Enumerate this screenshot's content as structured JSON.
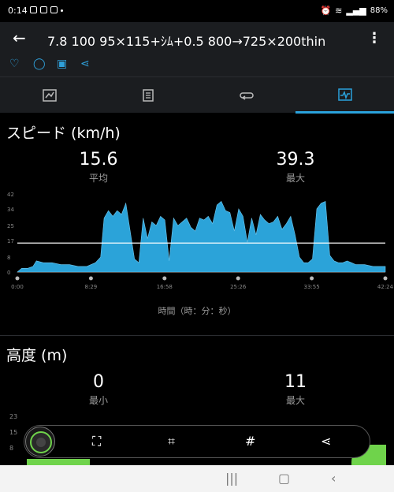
{
  "status": {
    "time": "0:14",
    "battery": "88%"
  },
  "toolbar": {
    "title": "7.8 100 95×115+ｼﾑ+0.5 800→725×200thin"
  },
  "speed": {
    "title": "スピード (km/h)",
    "avg_value": "15.6",
    "avg_label": "平均",
    "max_value": "39.3",
    "max_label": "最大"
  },
  "altitude": {
    "title": "高度 (m)",
    "min_value": "0",
    "min_label": "最小",
    "max_value": "11",
    "max_label": "最大",
    "y_ticks": [
      "23",
      "15",
      "8"
    ]
  },
  "chart_data": {
    "type": "area",
    "title": "スピード (km/h)",
    "xlabel": "時間（時：分：秒）",
    "ylabel": "",
    "x_ticks": [
      "0:00",
      "8:29",
      "16:58",
      "25:26",
      "33:55",
      "42:24"
    ],
    "y_ticks": [
      "42",
      "34",
      "25",
      "17",
      "8",
      "0"
    ],
    "ylim": [
      0,
      42
    ],
    "xlim": [
      0,
      42.4
    ],
    "average_line": 15.6,
    "color": "#2ba3d9",
    "series": [
      {
        "x": [
          0,
          0.5,
          1.2,
          1.8,
          2.2,
          3.0,
          4.0,
          5.0,
          6.0,
          7.0,
          8.0,
          9.0,
          9.6,
          10.0,
          10.5,
          11.0,
          11.5,
          12.0,
          12.5,
          13.0,
          13.5,
          14.0,
          14.5,
          15.0,
          15.5,
          16.0,
          16.5,
          17.0,
          17.5,
          18.0,
          18.5,
          19.0,
          19.5,
          20.0,
          20.5,
          21.0,
          21.5,
          22.0,
          22.5,
          23.0,
          23.5,
          24.0,
          24.5,
          25.0,
          25.5,
          26.0,
          26.5,
          27.0,
          27.5,
          28.0,
          28.5,
          29.0,
          29.5,
          30.0,
          30.5,
          31.0,
          31.5,
          32.0,
          32.5,
          33.0,
          33.5,
          34.0,
          34.5,
          35.0,
          35.5,
          36.0,
          36.5,
          37.0,
          37.5,
          38.0,
          38.5,
          39.0,
          40.0,
          41.0,
          42.0,
          42.4
        ],
        "y": [
          0,
          2,
          2,
          3,
          6,
          5,
          5,
          4,
          4,
          3,
          3,
          5,
          8,
          29,
          33,
          30,
          33,
          31,
          37,
          22,
          7,
          5,
          29,
          18,
          27,
          25,
          30,
          28,
          6,
          29,
          25,
          27,
          29,
          24,
          22,
          29,
          28,
          30,
          26,
          36,
          38,
          33,
          32,
          22,
          34,
          30,
          16,
          29,
          20,
          31,
          28,
          26,
          27,
          30,
          23,
          26,
          30,
          20,
          8,
          5,
          5,
          7,
          34,
          37,
          38,
          9,
          6,
          5,
          5,
          6,
          5,
          4,
          4,
          3,
          3,
          3
        ]
      }
    ]
  }
}
